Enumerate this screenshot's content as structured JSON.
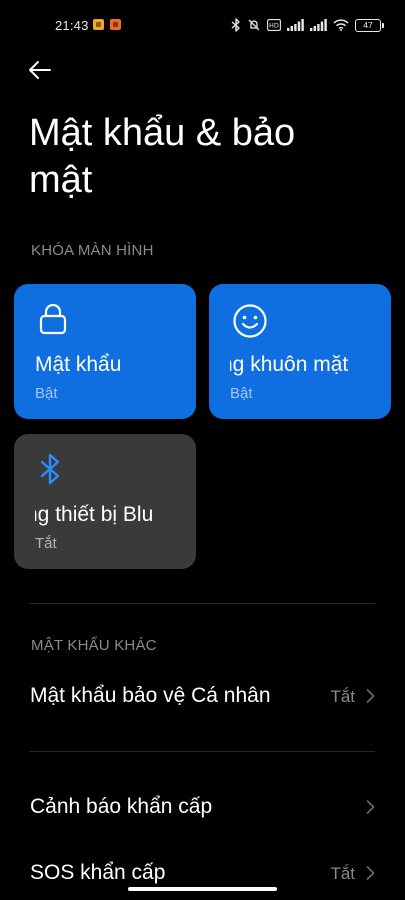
{
  "status_bar": {
    "time": "21:43",
    "battery": "47",
    "icons": [
      "bluetooth-icon",
      "silent-icon",
      "volte-icon",
      "signal-1-icon",
      "signal-2-icon",
      "wifi-icon",
      "battery-icon"
    ]
  },
  "header": {
    "back_icon": "back-arrow-icon",
    "title": "Mật khẩu & bảo mật"
  },
  "lock_screen": {
    "section_title": "KHÓA MÀN HÌNH",
    "cards": [
      {
        "label": "Mật khẩu",
        "status": "Bật",
        "icon": "lock-icon",
        "color": "#0f6fe0"
      },
      {
        "label": "ng khuôn mặt",
        "status": "Bật",
        "icon": "face-icon",
        "color": "#0f6fe0"
      },
      {
        "label": "ng thiết bị Blu",
        "status": "Tắt",
        "icon": "bluetooth-icon",
        "color": "#3a3a3a"
      }
    ]
  },
  "other_passwords": {
    "section_title": "MẬT KHẨU KHÁC",
    "items": [
      {
        "label": "Mật khẩu bảo vệ Cá nhân",
        "value": "Tắt"
      }
    ]
  },
  "emergency": {
    "items": [
      {
        "label": "Cảnh báo khẩn cấp",
        "value": ""
      },
      {
        "label": "SOS khẩn cấp",
        "value": "Tắt"
      }
    ]
  },
  "colors": {
    "background": "#000000",
    "accent": "#0f6fe0",
    "card_off": "#3a3a3a",
    "secondary_text": "#8a8a8a"
  }
}
